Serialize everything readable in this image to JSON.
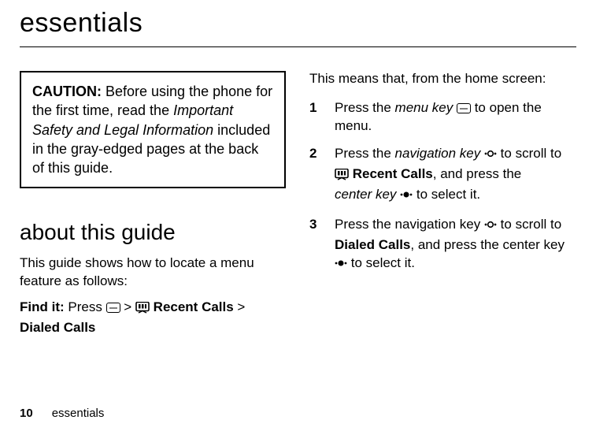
{
  "title": "essentials",
  "caution": {
    "label": "CAUTION:",
    "text_before_italic": " Before using the phone for the first time, read the ",
    "italic_text": "Important Safety and Legal Information",
    "text_after_italic": " included in the gray-edged pages at the back of this guide."
  },
  "subhead": "about this guide",
  "intro_text": "This guide shows how to locate a menu feature as follows:",
  "findit": {
    "label": "Find it:",
    "press": " Press ",
    "sep1": " > ",
    "recent_calls": " Recent Calls",
    "sep2": " > ",
    "dialed_calls": "Dialed Calls"
  },
  "right": {
    "intro": "This means that, from the home screen:",
    "items": [
      {
        "num": "1",
        "t1": "Press the ",
        "it1": "menu key ",
        "t2": " to open the menu."
      },
      {
        "num": "2",
        "t1": "Press the ",
        "it1": "navigation key ",
        "t2": " to scroll to ",
        "bold1": " Recent Calls",
        "t3": ", and press the ",
        "it2": "center key ",
        "t4": " to select it."
      },
      {
        "num": "3",
        "t1": "Press the navigation key ",
        "t2": " to scroll to ",
        "bold1": "Dialed Calls",
        "t3": ", and press the center key ",
        "t4": " to select it."
      }
    ]
  },
  "footer": {
    "page": "10",
    "section": "essentials"
  }
}
